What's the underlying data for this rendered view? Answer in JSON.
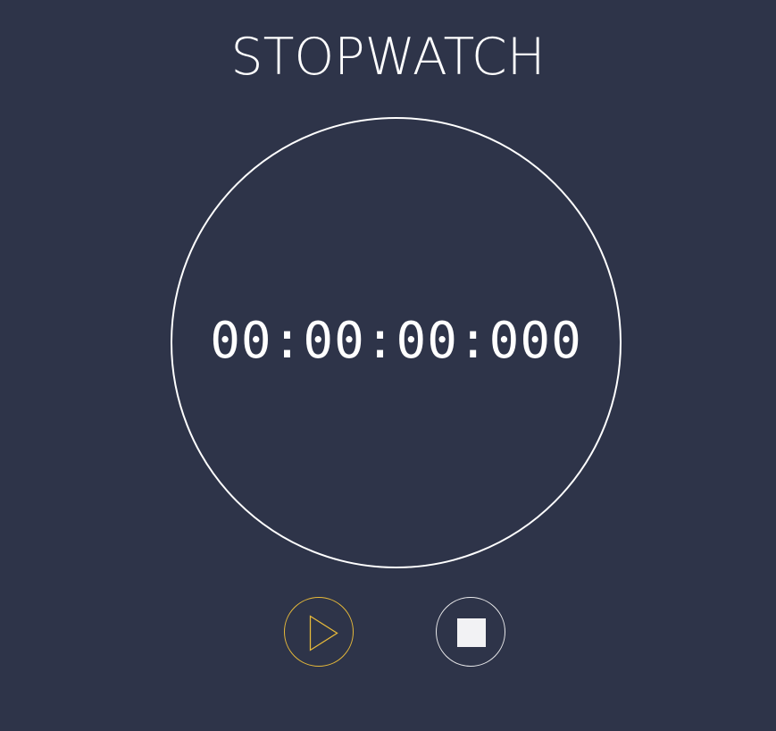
{
  "app": {
    "title": "STOPWATCH"
  },
  "timer": {
    "display": "00:00:00:000"
  },
  "controls": {
    "start_icon": "play-icon",
    "stop_icon": "stop-icon"
  },
  "colors": {
    "background": "#2e3449",
    "foreground": "#ffffff",
    "accent": "#e6b93a",
    "stop_fill": "#f2f2f4"
  }
}
